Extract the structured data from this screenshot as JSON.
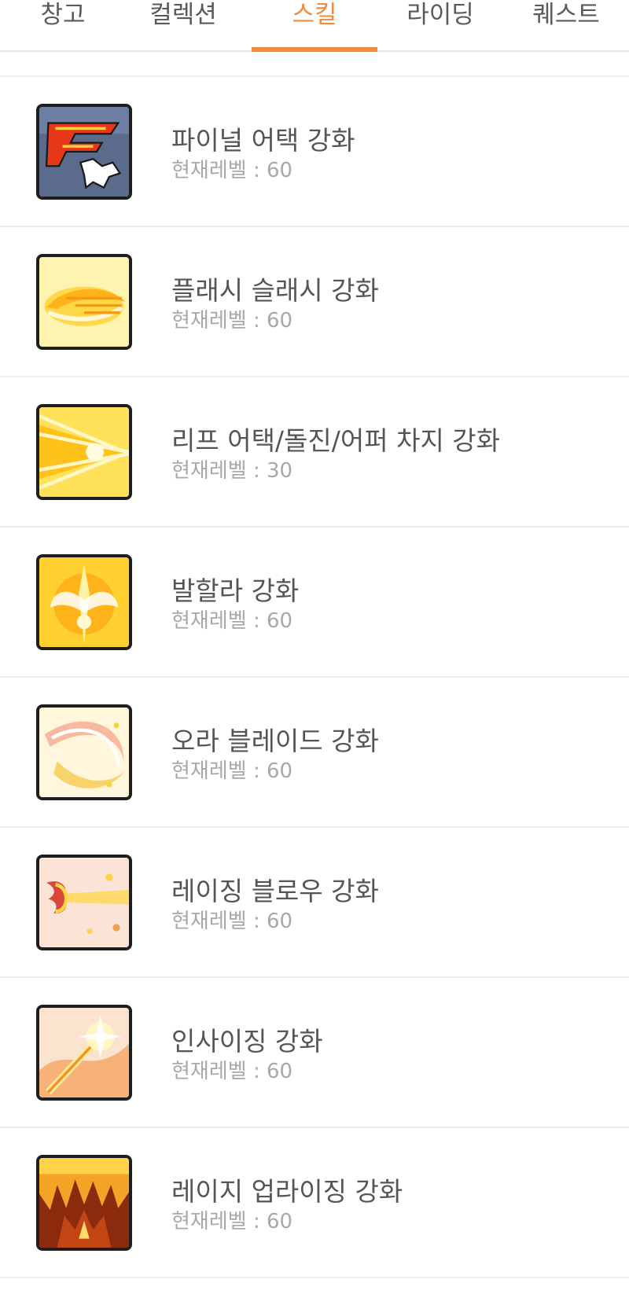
{
  "tabs": [
    {
      "label": "창고",
      "active": false
    },
    {
      "label": "컬렉션",
      "active": false
    },
    {
      "label": "스킬",
      "active": true
    },
    {
      "label": "라이딩",
      "active": false
    },
    {
      "label": "퀘스트",
      "active": false
    }
  ],
  "accent_color": "#f08a3c",
  "level_prefix": "현재레벨 : ",
  "skills": [
    {
      "name": "파이널 어택 강화",
      "level": "60",
      "icon": "final-attack-icon"
    },
    {
      "name": "플래시 슬래시 강화",
      "level": "60",
      "icon": "flash-slash-icon"
    },
    {
      "name": "리프 어택/돌진/어퍼 차지 강화",
      "level": "30",
      "icon": "leap-attack-icon"
    },
    {
      "name": "발할라 강화",
      "level": "60",
      "icon": "valhalla-icon"
    },
    {
      "name": "오라 블레이드 강화",
      "level": "60",
      "icon": "aura-blade-icon"
    },
    {
      "name": "레이징 블로우 강화",
      "level": "60",
      "icon": "raging-blow-icon"
    },
    {
      "name": "인사이징 강화",
      "level": "60",
      "icon": "incising-icon"
    },
    {
      "name": "레이지 업라이징 강화",
      "level": "60",
      "icon": "rage-uprising-icon"
    }
  ]
}
